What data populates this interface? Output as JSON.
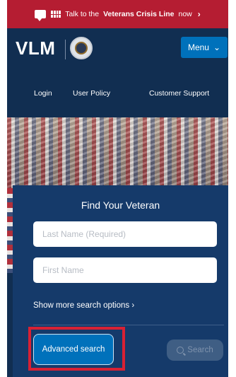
{
  "crisis_bar": {
    "text_before": "Talk to the",
    "text_bold": "Veterans Crisis Line",
    "text_after": "now",
    "chevron": "›"
  },
  "header": {
    "logo": "VLM",
    "menu_label": "Menu",
    "menu_chevron": "⌄"
  },
  "nav": {
    "items": [
      "Login",
      "User Policy",
      "Customer Support"
    ]
  },
  "search_panel": {
    "title": "Find Your Veteran",
    "last_name_placeholder": "Last Name (Required)",
    "first_name_placeholder": "First Name",
    "more_options": "Show more search options ›",
    "advanced_label": "Advanced search",
    "search_label": "Search"
  },
  "icons": {
    "crisis": "speech-bubble-icon",
    "seal": "va-seal-icon",
    "search": "search-icon"
  },
  "colors": {
    "crisis_red": "#b51d32",
    "navy": "#112e51",
    "panel_blue": "#153a6a",
    "primary_blue": "#0071bb",
    "highlight_red": "#d82134"
  }
}
